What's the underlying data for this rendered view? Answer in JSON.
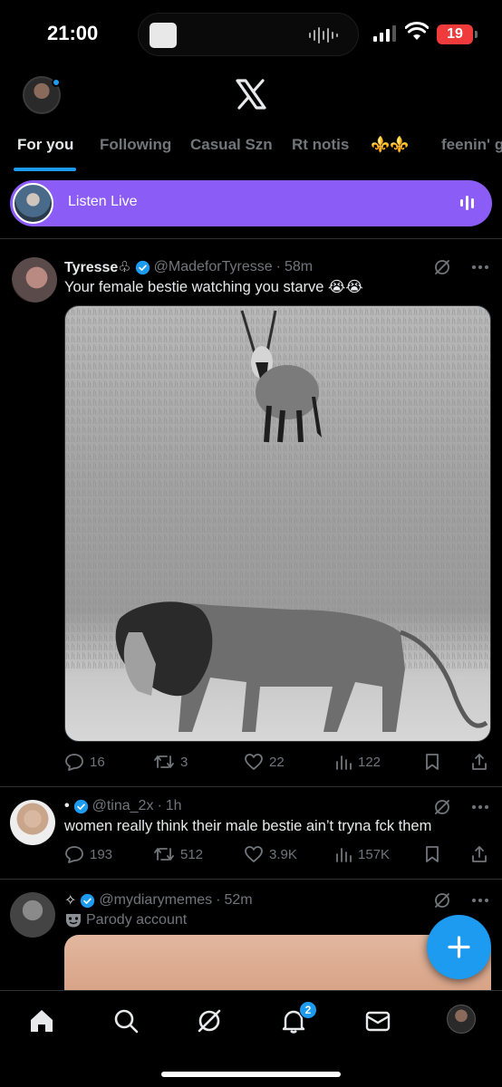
{
  "status_bar": {
    "time": "21:00",
    "battery": "19"
  },
  "tabs": [
    "For you",
    "Following",
    "Casual Szn",
    "Rt notis",
    "⚜️⚜️",
    "feenin' g"
  ],
  "listen_live": {
    "label": "Listen Live"
  },
  "posts": [
    {
      "name": "Tyresse♧",
      "handle": "@MadeforTyresse",
      "time": "58m",
      "text": "Your female bestie watching you starve 😭😭",
      "replies": "16",
      "reposts": "3",
      "likes": "22",
      "views": "122"
    },
    {
      "name": "•",
      "handle": "@tina_2x",
      "time": "1h",
      "text": "women really think their male bestie ain’t tryna fck them",
      "replies": "193",
      "reposts": "512",
      "likes": "3.9K",
      "views": "157K"
    },
    {
      "name": "✧",
      "handle": "@mydiarymemes",
      "time": "52m",
      "label": "Parody account"
    }
  ],
  "notifications_badge": "2",
  "colors": {
    "accent": "#1d9bf0",
    "live": "#8b5cf6",
    "battery": "#ef3b3b"
  }
}
